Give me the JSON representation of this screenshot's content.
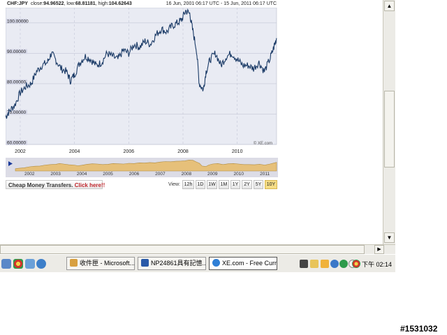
{
  "chart": {
    "pair": "CHF:JPY",
    "close_label": "close:",
    "close_value": "94.96522",
    "low_label": "low:",
    "low_value": "68.81181",
    "high_label": "high:",
    "high_value": "104.62643",
    "date_range": "16 Jun, 2001 06:17 UTC - 15 Jun, 2011 06:17 UTC",
    "watermark": "© XE.com"
  },
  "chart_data": {
    "type": "line",
    "title": "",
    "xlabel": "",
    "ylabel": "",
    "ylim": [
      60,
      105
    ],
    "xlim": [
      2001.46,
      2011.45
    ],
    "y_ticks": [
      "100.00000",
      "90.00000",
      "80.00000",
      "70.00000",
      "60.00000"
    ],
    "y_tick_values": [
      100,
      90,
      80,
      70,
      60
    ],
    "x_ticks": [
      "2002",
      "2004",
      "2006",
      "2008",
      "2010"
    ],
    "x_tick_values": [
      2002,
      2004,
      2006,
      2008,
      2010
    ],
    "grid": true,
    "series": [
      {
        "x": [
          2001.46,
          2001.6,
          2001.8,
          2002.0,
          2002.2,
          2002.4,
          2002.6,
          2002.8,
          2003.0,
          2003.15,
          2003.3,
          2003.5,
          2003.7,
          2003.85,
          2004.0,
          2004.2,
          2004.4,
          2004.6,
          2004.8,
          2005.0,
          2005.2,
          2005.4,
          2005.6,
          2005.8,
          2006.0,
          2006.2,
          2006.4,
          2006.6,
          2006.8,
          2007.0,
          2007.2,
          2007.4,
          2007.6,
          2007.8,
          2007.95,
          2008.1,
          2008.25,
          2008.35,
          2008.5,
          2008.6,
          2008.75,
          2008.85,
          2009.0,
          2009.2,
          2009.4,
          2009.6,
          2009.8,
          2010.0,
          2010.2,
          2010.4,
          2010.6,
          2010.8,
          2011.0,
          2011.2,
          2011.35,
          2011.45
        ],
        "y": [
          69,
          71,
          73,
          77,
          79,
          80,
          84,
          86,
          87,
          90,
          88,
          85,
          84,
          81,
          83,
          87,
          89,
          88,
          86,
          87,
          90,
          89,
          88,
          91,
          90,
          93,
          92,
          94,
          93,
          96,
          98,
          97,
          99,
          100,
          101,
          104,
          103,
          98,
          91,
          80,
          78,
          84,
          88,
          90,
          86,
          89,
          90,
          88,
          86,
          86,
          85,
          87,
          84,
          88,
          92,
          95
        ]
      }
    ],
    "navigator_ticks": [
      "2002",
      "2003",
      "2004",
      "2005",
      "2006",
      "2007",
      "2008",
      "2009",
      "2010",
      "2011"
    ],
    "navigator_tick_values": [
      2002,
      2003,
      2004,
      2005,
      2006,
      2007,
      2008,
      2009,
      2010,
      2011
    ]
  },
  "footer": {
    "promo_text": "Cheap Money Transfers.",
    "promo_link": "Click here!!",
    "view_label": "View:",
    "timeframes": [
      "12h",
      "1D",
      "1W",
      "1M",
      "1Y",
      "2Y",
      "5Y",
      "10Y"
    ],
    "active_timeframe": "10Y"
  },
  "taskbar": {
    "tasks": [
      {
        "label": "收件匣 - Microsoft...",
        "icon": "outlook-icon",
        "color": "#d8a040"
      },
      {
        "label": "NP24861具有記憶...",
        "icon": "word-icon",
        "color": "#2a5aa8"
      },
      {
        "label": "XE.com - Free Curr...",
        "icon": "ie-icon",
        "color": "#2f7fd6"
      }
    ],
    "clock": "下午 02:14"
  },
  "image_id": "#1531032",
  "colors": {
    "line": "#1a3a66",
    "plot_bg": "#e9ebf3",
    "nav_fill": "#e6c07a",
    "nav_line": "#b08a3a",
    "active_tf": "#f5dd86"
  }
}
